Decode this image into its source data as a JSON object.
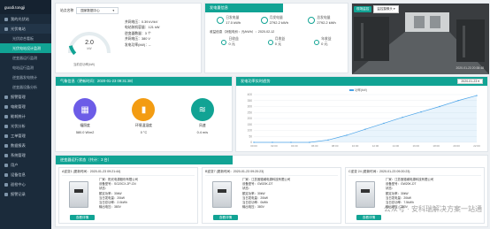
{
  "sidebar": {
    "brand": "guodi.tongji",
    "items": [
      {
        "label": "我的光伏站",
        "open": false
      },
      {
        "label": "光伏电站",
        "open": true,
        "subs": [
          "光伏综合看板",
          "光伏电站设计监测",
          "逆变器运行监测",
          "电站运行监测",
          "逆变器发电统计",
          "逆变器设备分析"
        ],
        "active": 1
      },
      {
        "label": "报警管理"
      },
      {
        "label": "电能管理"
      },
      {
        "label": "能耗统计"
      },
      {
        "label": "光伏分析"
      },
      {
        "label": "工单管理"
      },
      {
        "label": "数据报表"
      },
      {
        "label": "系统管理"
      },
      {
        "label": "用户"
      },
      {
        "label": "设备信息"
      },
      {
        "label": "巡检中心"
      },
      {
        "label": "报警记录"
      }
    ]
  },
  "top_left": {
    "station_label": "站点名称",
    "station_value": "国家数据中心",
    "meta": [
      {
        "k": "并网电压：",
        "v": "0.39 kV/kV"
      },
      {
        "k": "电站装机容量：",
        "v": "121 kW"
      },
      {
        "k": "逆变器数量：",
        "v": "3 个"
      },
      {
        "k": "并网电压：",
        "v": "380 V"
      },
      {
        "k": "发电功率(kW)：",
        "v": "--"
      }
    ],
    "gauge_value": "2.0",
    "gauge_unit": "kW",
    "gauge_caption": "当前总功率(kW)",
    "gauge_fraction": 0.1
  },
  "kpis": {
    "title": "发电量信息",
    "items": [
      {
        "label": "日发电量",
        "value": "17.0 kWh"
      },
      {
        "label": "月发电量",
        "value": "2792.2 kWh"
      },
      {
        "label": "总发电量",
        "value": "2792.2 kWh"
      }
    ],
    "sub_title": "收益信息（补贴电价：元/kWh）：2020-02-12",
    "sub_items": [
      {
        "label": "日收益",
        "value": "0 元"
      },
      {
        "label": "月收益",
        "value": "0 元"
      },
      {
        "label": "年收益",
        "value": "0 元"
      }
    ]
  },
  "camera": {
    "title": "现场监控",
    "tag": "监控摄像头",
    "timestamp": "2020-01-23 20:38:48"
  },
  "weather": {
    "title": "气象信息（更新时间：2020-01-23 09:31:38）",
    "items": [
      {
        "label": "辐照度",
        "value": "580.0 W/m2",
        "icon": "solar-panel-icon",
        "color": "#6c5ce7"
      },
      {
        "label": "环境温湿度",
        "value": "0 °C",
        "icon": "thermometer-icon",
        "color": "#f39c12"
      },
      {
        "label": "风速",
        "value": "0.4 m/s",
        "icon": "wind-icon",
        "color": "#11a394"
      }
    ]
  },
  "chart": {
    "title": "发电功率实时趋势",
    "date": "2020-01-23",
    "legend": "功率(kW)",
    "yticks": [
      "400",
      "350",
      "300",
      "250",
      "200",
      "150",
      "100",
      "50",
      "0"
    ],
    "xticks": [
      "00:00",
      "02:00",
      "04:00",
      "06:00",
      "08:00",
      "10:00",
      "12:00",
      "14:00",
      "16:00",
      "18:00",
      "20:00",
      "22:00"
    ]
  },
  "chart_data": {
    "type": "line",
    "x": [
      "00:00",
      "02:00",
      "04:00",
      "06:00",
      "08:00",
      "10:00",
      "12:00",
      "14:00",
      "16:00",
      "18:00",
      "20:00",
      "22:00",
      "23:59"
    ],
    "series": [
      {
        "name": "功率(kW)",
        "values": [
          0,
          0,
          0,
          0,
          20,
          60,
          110,
          160,
          210,
          255,
          300,
          350,
          392
        ]
      }
    ],
    "ylim": [
      0,
      400
    ]
  },
  "inverters": {
    "title": "逆变器运行状态（共计：3 台）",
    "cards": [
      {
        "title": "A逆变1 (更新时间：2020-01-23 09:21:44)",
        "mfr": "厂家：阳光电源股份有限公司",
        "model": "设备型号：SG20CX-2P-CN",
        "status": "状态：",
        "power": "额定功率：30kW",
        "dc": "当日发电量：20kW",
        "total": "当日总功率：2.0kWh",
        "ac": "输出电压：380V",
        "btn": "查看详情"
      },
      {
        "title": "B逆变7 (更新时间：2020-01-23 09:20:23)",
        "mfr": "厂家：江苏固德威电源科技有限公司",
        "model": "设备型号：GW20K-DT",
        "status": "状态：",
        "power": "额定功率：30kW",
        "dc": "当日发电量：20kW",
        "total": "当日总功率：0kWh",
        "ac": "输出电压：380V",
        "btn": "查看详情"
      },
      {
        "title": "C逆变 24 (更新时间：2020-01-23 09:20:23)",
        "mfr": "厂家：江苏固德威电源科技有限公司",
        "model": "设备型号：GW20K-DT",
        "status": "状态：",
        "power": "额定功率：30kW",
        "dc": "当日发电量：20kW",
        "total": "当日总功率：7.5kWh",
        "ac": "输出电压：380V",
        "btn": "查看详情"
      }
    ]
  },
  "watermark": "公众号 · 安科瑞解决方案一站通"
}
